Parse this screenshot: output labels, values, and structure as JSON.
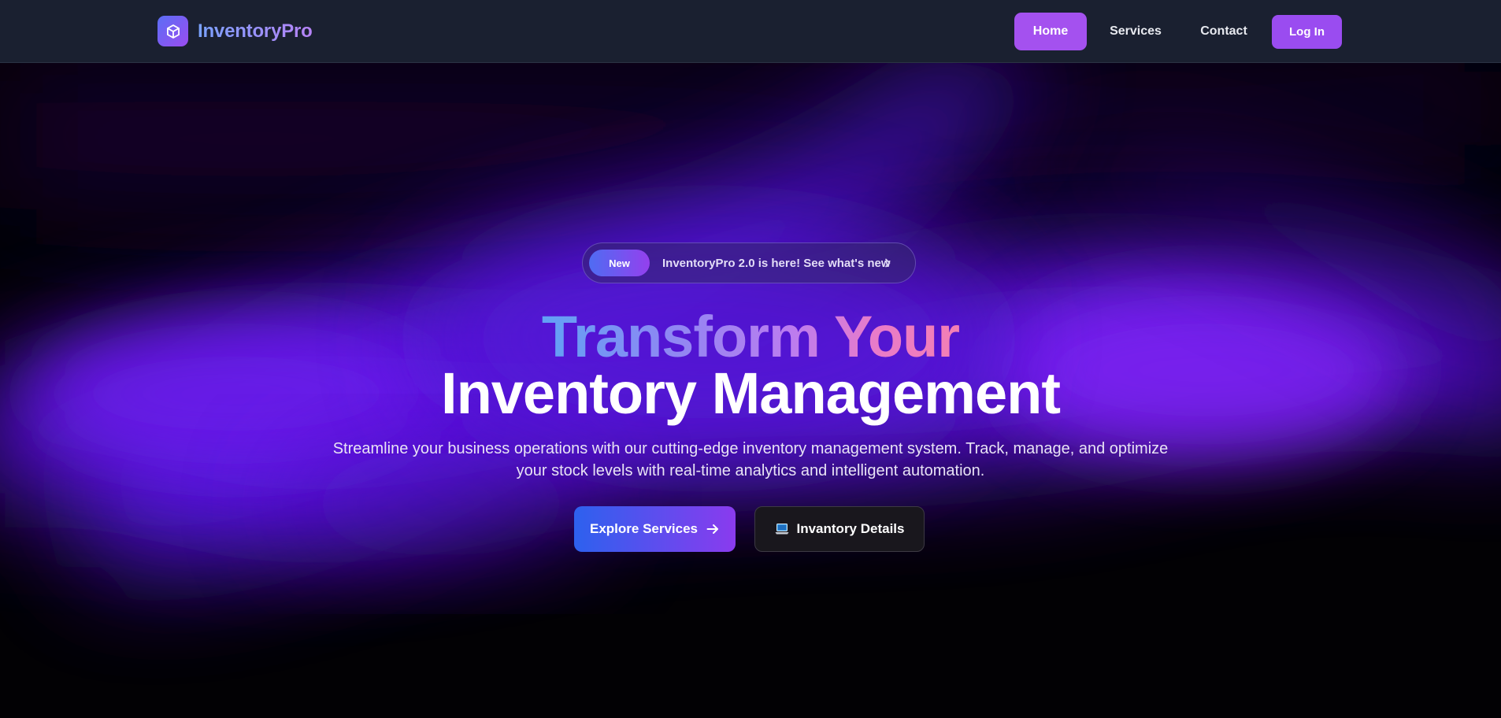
{
  "brand": {
    "name": "InventoryPro",
    "logo_icon": "cube-icon"
  },
  "nav": {
    "items": [
      {
        "label": "Home",
        "active": true
      },
      {
        "label": "Services",
        "active": false
      },
      {
        "label": "Contact",
        "active": false
      }
    ],
    "login_label": "Log In"
  },
  "announcement": {
    "badge": "New",
    "text": "InventoryPro 2.0 is here! See what's new",
    "icon": "chevron-right-icon"
  },
  "hero": {
    "title_line1": "Transform Your",
    "title_line2": "Inventory Management",
    "subtitle_line1": "Streamline your business operations with our cutting-edge inventory management system. Track, manage, and optimize",
    "subtitle_line2": "your stock levels with real-time analytics and intelligent automation.",
    "primary_button": "Explore Services",
    "primary_icon": "arrow-right-icon",
    "secondary_button": "Invantory Details",
    "secondary_icon": "laptop-icon"
  },
  "colors": {
    "nav_bg": "#1a2030",
    "accent": "#a451ef",
    "glow": "#6a1fe8",
    "page_bg": "#020104"
  }
}
